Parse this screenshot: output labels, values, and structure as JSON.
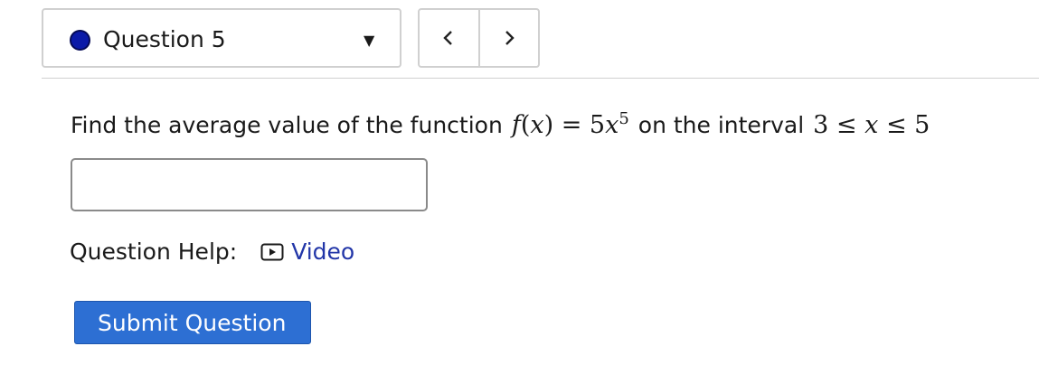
{
  "question_selector": {
    "label": "Question 5",
    "status_color": "#0b1aa8",
    "caret": "▼"
  },
  "nav": {
    "prev_icon": "chevron-left-icon",
    "next_icon": "chevron-right-icon"
  },
  "question": {
    "prompt_before": "Find the average value of the function",
    "fx": "f(x) = 5x",
    "exponent": "5",
    "prompt_middle": "on the interval",
    "interval": "3 ≤ x ≤ 5"
  },
  "answer_input": {
    "value": "",
    "placeholder": ""
  },
  "help": {
    "label": "Question Help:",
    "video_label": "Video",
    "video_icon": "play-video-icon",
    "link_color": "#2236a8"
  },
  "submit": {
    "label": "Submit Question",
    "color": "#2d6fd3"
  }
}
